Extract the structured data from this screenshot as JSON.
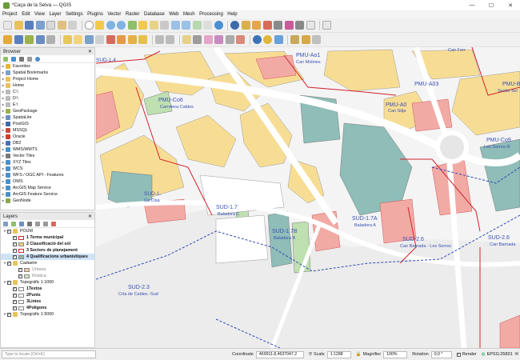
{
  "window": {
    "title": "*Caça de la Selva — QGIS",
    "controls": [
      "—",
      "☐",
      "✕"
    ]
  },
  "menu": [
    "Project",
    "Edit",
    "View",
    "Layer",
    "Settings",
    "Plugins",
    "Vector",
    "Raster",
    "Database",
    "Web",
    "Mesh",
    "Processing",
    "Help"
  ],
  "browser": {
    "title": "Browser",
    "items": [
      {
        "label": "Favorites",
        "icon": "star-icon",
        "color": "#e8b530"
      },
      {
        "label": "Spatial Bookmarks",
        "icon": "bookmark-icon",
        "color": "#7aa1c9"
      },
      {
        "label": "Project Home",
        "icon": "folder-icon",
        "color": "#e9c25b"
      },
      {
        "label": "Home",
        "icon": "folder-icon",
        "color": "#e9c25b"
      },
      {
        "label": "C:\\",
        "icon": "drive-icon",
        "color": "#bbbbbb"
      },
      {
        "label": "D:\\",
        "icon": "drive-icon",
        "color": "#bbbbbb"
      },
      {
        "label": "E:\\",
        "icon": "drive-icon",
        "color": "#bbbbbb"
      },
      {
        "label": "GeoPackage",
        "icon": "geopackage-icon",
        "color": "#9ab24a"
      },
      {
        "label": "SpatiaLite",
        "icon": "spatialite-icon",
        "color": "#6b8cc2"
      },
      {
        "label": "PostGIS",
        "icon": "postgis-icon",
        "color": "#3d6aa8"
      },
      {
        "label": "MSSQL",
        "icon": "mssql-icon",
        "color": "#c74a3a"
      },
      {
        "label": "Oracle",
        "icon": "oracle-icon",
        "color": "#d13b2e"
      },
      {
        "label": "DB2",
        "icon": "db2-icon",
        "color": "#4a6fb0"
      },
      {
        "label": "WMS/WMTS",
        "icon": "wms-icon",
        "color": "#4a90c8"
      },
      {
        "label": "Vector Tiles",
        "icon": "vector-tiles-icon",
        "color": "#7a7a7a"
      },
      {
        "label": "XYZ Tiles",
        "icon": "xyz-tiles-icon",
        "color": "#4a90c8"
      },
      {
        "label": "WCS",
        "icon": "wcs-icon",
        "color": "#4a90c8"
      },
      {
        "label": "WFS / OGC API - Features",
        "icon": "wfs-icon",
        "color": "#4a90c8"
      },
      {
        "label": "OWS",
        "icon": "ows-icon",
        "color": "#4a90c8"
      },
      {
        "label": "ArcGIS Map Service",
        "icon": "arcgis-icon",
        "color": "#4a90c8"
      },
      {
        "label": "ArcGIS Feature Service",
        "icon": "arcgis-icon",
        "color": "#4a90c8"
      },
      {
        "label": "GeoNode",
        "icon": "geonode-icon",
        "color": "#8aa84a"
      }
    ]
  },
  "layers": {
    "title": "Layers",
    "items": [
      {
        "label": "POUM",
        "indent": 0,
        "group": true,
        "bold": false
      },
      {
        "label": "1 Terme municipal",
        "indent": 1,
        "swatch": "#ffffff",
        "swatchBorder": "#d2232a",
        "bold": true
      },
      {
        "label": "2 Classificació del sòl",
        "indent": 1,
        "swatch": "#f0d27a",
        "swatchBorder": "#888",
        "bold": true
      },
      {
        "label": "3 Sectors de planejament",
        "indent": 1,
        "swatch": "#ffffff",
        "swatchBorder": "#d2232a",
        "bold": true
      },
      {
        "label": "4 Qualificacions urbanístiques",
        "indent": 1,
        "swatch": "#9ab89f",
        "swatchBorder": "#888",
        "bold": true,
        "selected": true
      },
      {
        "label": "Cadastre",
        "indent": 0,
        "group": true
      },
      {
        "label": "Urbana",
        "indent": 2,
        "swatch": "#f3c9a8",
        "swatchBorder": "#888",
        "dim": true
      },
      {
        "label": "Rústica",
        "indent": 2,
        "swatch": "#cfe6c2",
        "swatchBorder": "#888",
        "dim": true
      },
      {
        "label": "Topogràfic 1:1000",
        "indent": 0,
        "group": true
      },
      {
        "label": "1Textos",
        "indent": 1,
        "swatch": "#ffffff",
        "swatchBorder": "#888",
        "bold": true
      },
      {
        "label": "2Punts",
        "indent": 1,
        "swatch": "#ffffff",
        "swatchBorder": "#888",
        "bold": true
      },
      {
        "label": "3Linies",
        "indent": 1,
        "swatch": "#ffffff",
        "swatchBorder": "#888",
        "bold": true
      },
      {
        "label": "4Poligons",
        "indent": 1,
        "swatch": "#ffffff",
        "swatchBorder": "#888",
        "bold": true
      },
      {
        "label": "Topogràfic 1:5000",
        "indent": 0,
        "group": true
      }
    ]
  },
  "map": {
    "labels": [
      {
        "t": "PMU-Ao1",
        "c": "#3a4fb8"
      },
      {
        "t": "Can Molines",
        "c": "#3a4fb8"
      },
      {
        "t": "PMU-Co6",
        "c": "#3a4fb8"
      },
      {
        "t": "Carretera Caldes",
        "c": "#3a4fb8"
      },
      {
        "t": "PMU-A03",
        "c": "#3a4fb8"
      },
      {
        "t": "PMU-A0",
        "c": "#3a4fb8"
      },
      {
        "t": "Can Sitja",
        "c": "#3a4fb8"
      },
      {
        "t": "PMU-B",
        "c": "#3a4fb8"
      },
      {
        "t": "Sector del",
        "c": "#3a4fb8"
      },
      {
        "t": "PMU-Co9",
        "c": "#3a4fb8"
      },
      {
        "t": "Les Serres III",
        "c": "#3a4fb8"
      },
      {
        "t": "SUD-1.7",
        "c": "#3a4fb8"
      },
      {
        "t": "Baladora C",
        "c": "#3a4fb8"
      },
      {
        "t": "SUD-1.7B",
        "c": "#3a4fb8"
      },
      {
        "t": "Baladora B",
        "c": "#3a4fb8"
      },
      {
        "t": "SUD-1.7A",
        "c": "#3a4fb8"
      },
      {
        "t": "Baladora A",
        "c": "#3a4fb8"
      },
      {
        "t": "SUD-2.6",
        "c": "#3a4fb8"
      },
      {
        "t": "Can Barnada - Les Serres",
        "c": "#3a4fb8"
      },
      {
        "t": "SUD-2.6",
        "c": "#3a4fb8"
      },
      {
        "t": "Can Barnada",
        "c": "#3a4fb8"
      },
      {
        "t": "SUD-2.3",
        "c": "#3a4fb8"
      },
      {
        "t": "Crta de Caldes -Sud",
        "c": "#3a4fb8"
      },
      {
        "t": "Can Ferr",
        "c": "#3a4fb8"
      },
      {
        "t": "SUD-1.4",
        "c": "#3a4fb8"
      },
      {
        "t": "SUD-1.",
        "c": "#3a4fb8"
      },
      {
        "t": "Ca Cisa",
        "c": "#3a4fb8"
      }
    ]
  },
  "status": {
    "locator_placeholder": "Type to locate (Ctrl+K)",
    "coordinate_label": "Coordinate",
    "coordinate_value": "469911.8,4637047.2",
    "scale_label": "Scale",
    "scale_value": "1:1288",
    "magnifier_label": "Magnifier",
    "magnifier_value": "100%",
    "rotation_label": "Rotation",
    "rotation_value": "0,0 °",
    "render_label": "Render",
    "crs": "EPSG:25831"
  }
}
